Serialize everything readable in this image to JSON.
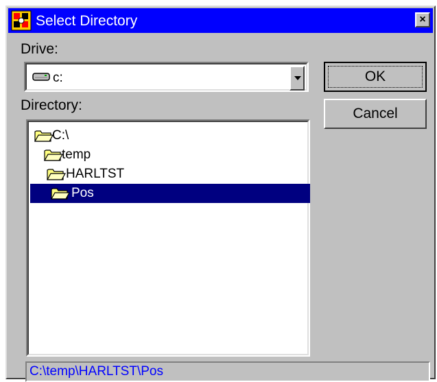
{
  "window": {
    "title": "Select Directory",
    "close_symbol": "×"
  },
  "drive": {
    "label": "Drive:",
    "value": "c:",
    "icon": "hard-drive-icon"
  },
  "directory": {
    "label": "Directory:",
    "items": [
      {
        "name": "C:\\",
        "icon": "open-folder-icon",
        "selected": false
      },
      {
        "name": "temp",
        "icon": "open-folder-icon",
        "selected": false
      },
      {
        "name": "HARLTST",
        "icon": "open-folder-icon",
        "selected": false
      },
      {
        "name": "Pos",
        "icon": "open-folder-icon",
        "selected": true
      }
    ]
  },
  "buttons": {
    "ok": "OK",
    "cancel": "Cancel"
  },
  "status": {
    "path": "C:\\temp\\HARLTST\\Pos"
  },
  "colors": {
    "titlebar": "#0000ff",
    "face": "#c0c0c0",
    "selection": "#000080",
    "status_text": "#0000ff"
  }
}
